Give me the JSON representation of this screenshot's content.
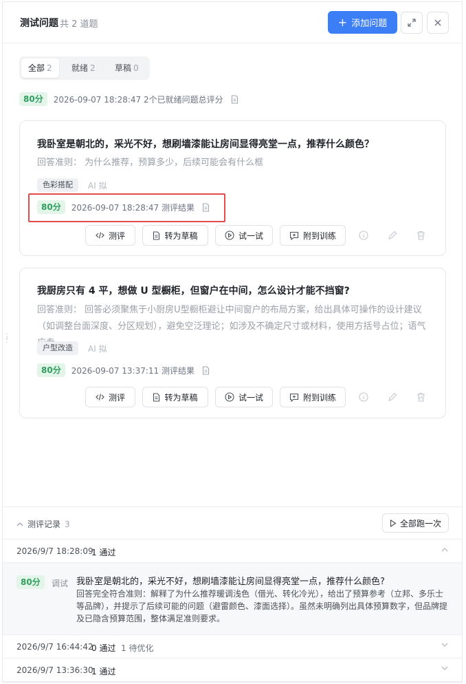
{
  "header": {
    "title": "测试问题",
    "count": "共 2 道题",
    "add_label": "添加问题"
  },
  "tabs": [
    {
      "label": "全部",
      "count": "2"
    },
    {
      "label": "就绪",
      "count": "2"
    },
    {
      "label": "草稿",
      "count": "0"
    }
  ],
  "summary": {
    "score": "80分",
    "text": "2026-09-07 18:28:47 2个已就绪问题总评分"
  },
  "cards": [
    {
      "title": "我卧室是朝北的，采光不好，想刷墙漆能让房间显得亮堂一点，推荐什么颜色？",
      "criteria": "回答准则： 为什么推荐，预算多少，后续可能会有什么框",
      "tag": "色彩搭配",
      "ai": "AI 拟",
      "score": "80分",
      "meta": "2026-09-07 18:28:47 测评结果"
    },
    {
      "title": "我厨房只有 4 平，想做 U 型橱柜，但窗户在中间，怎么设计才能不挡窗?",
      "criteria": "回答准则： 回答必须聚焦于小厨房U型橱柜避让中间窗户的布局方案，给出具体可操作的设计建议（如调整台面深度、分区规划），避免空泛理论；如涉及不确定尺寸或材料，使用方括号占位；语气应专...",
      "tag": "户型改造",
      "ai": "AI 拟",
      "score": "80分",
      "meta": "2026-09-07 13:37:11 测评结果"
    }
  ],
  "actions": {
    "evaluate": "测评",
    "to_draft": "转为草稿",
    "try": "试一试",
    "attach": "附到训练"
  },
  "eval": {
    "title": "测评记录",
    "count": "3",
    "run_all": "全部跑一次",
    "records": [
      {
        "time": "2026/9/7 18:28:09",
        "pass": "1 通过",
        "opt": ""
      },
      {
        "time": "2026/9/7 16:44:42",
        "pass": "0 通过",
        "opt": "1 待优化"
      },
      {
        "time": "2026/9/7 13:36:30",
        "pass": "1 通过",
        "opt": ""
      }
    ],
    "detail": {
      "score": "80分",
      "tag": "调试",
      "question": "我卧室是朝北的，采光不好，想刷墙漆能让房间显得亮堂一点，推荐什么颜色?",
      "answer": "回答完全符合准则：解释了为什么推荐暖调浅色（借光、转化冷光），给出了预算参考（立邦、多乐士等品牌），并提示了后续可能的问题（避雷颜色、漆面选择）。虽然未明确列出具体预算数字，但品牌提及已隐含预算范围，整体满足准则要求。"
    }
  }
}
